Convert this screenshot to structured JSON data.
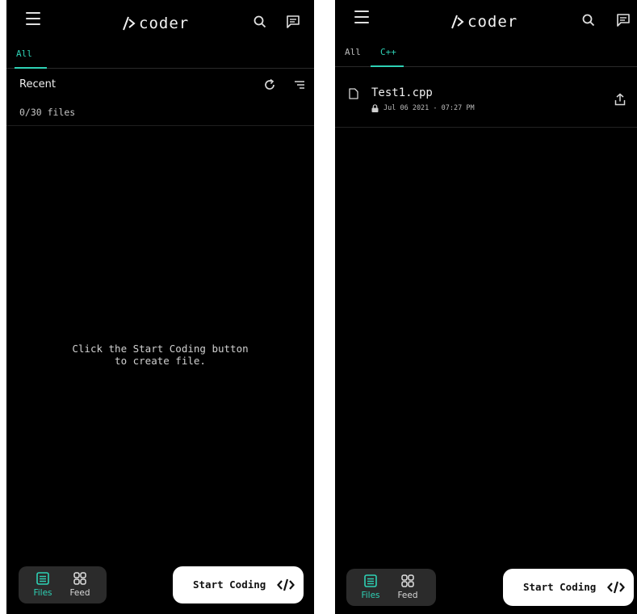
{
  "app": {
    "logo_text": "coder"
  },
  "left": {
    "tabs": [
      {
        "label": "All",
        "active": true
      }
    ],
    "section": {
      "title": "Recent",
      "count": "0/30 files"
    },
    "empty_message": {
      "line1": "Click the Start Coding button",
      "line2": "to create file."
    }
  },
  "right": {
    "tabs": [
      {
        "label": "All",
        "active": false
      },
      {
        "label": "C++",
        "active": true
      }
    ],
    "files": [
      {
        "name": "Test1.cpp",
        "timestamp": "Jul 06 2021 - 07:27 PM"
      }
    ]
  },
  "bottom_nav": {
    "items": [
      {
        "label": "Files",
        "icon": "list-box-icon",
        "active": true
      },
      {
        "label": "Feed",
        "icon": "grid-icon",
        "active": false
      }
    ]
  },
  "fab": {
    "label": "Start Coding",
    "icon": "code-brackets-icon"
  },
  "colors": {
    "background": "#000000",
    "accent": "#2ed1b5",
    "nav_bg": "#2b2b2b",
    "fab_bg": "#ffffff"
  }
}
